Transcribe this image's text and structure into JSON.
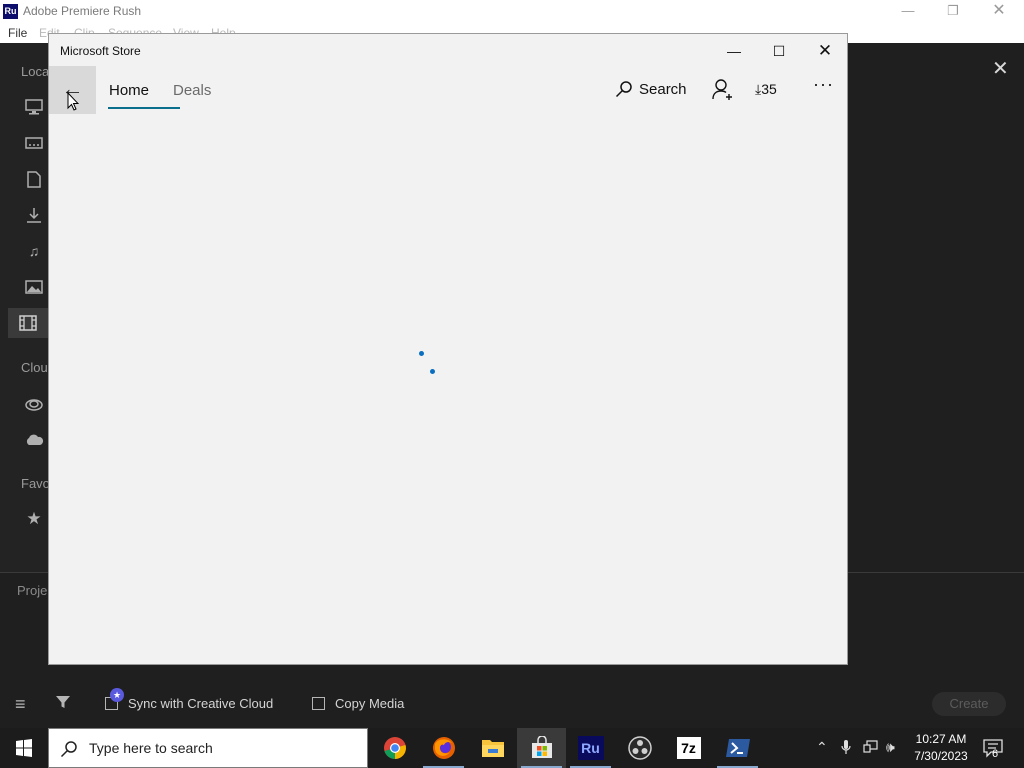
{
  "rush": {
    "title": "Adobe Premiere Rush",
    "logo": "Ru",
    "menu": [
      "File",
      "Edit",
      "Clip",
      "Sequence",
      "View",
      "Help"
    ],
    "sidebar": {
      "local_label": "Loca",
      "cloud_label": "Clou",
      "favorites_label": "Favo",
      "icons": [
        "monitor-icon",
        "drive-icon",
        "document-icon",
        "download-icon",
        "music-icon",
        "image-icon",
        "film-icon",
        "creative-cloud-icon",
        "cloud-icon",
        "star-icon"
      ]
    },
    "project_label": "Proje",
    "footer": {
      "sync_label": "Sync with Creative Cloud",
      "copy_media_label": "Copy Media",
      "create_label": "Create"
    }
  },
  "store": {
    "title": "Microsoft Store",
    "tabs": [
      {
        "label": "Home",
        "selected": true
      },
      {
        "label": "Deals",
        "selected": false
      }
    ],
    "search_label": "Search",
    "downloads_count": "35",
    "more_label": "···",
    "accent": "#0a6f8c",
    "spinner_color": "#0a6fc0"
  },
  "taskbar": {
    "search_placeholder": "Type here to search",
    "apps": [
      "chrome-icon",
      "firefox-icon",
      "file-explorer-icon",
      "microsoft-store-icon",
      "premiere-rush-icon",
      "obs-icon",
      "7zip-icon",
      "powershell-icon"
    ],
    "rush_label": "Ru",
    "zip_label": "7z",
    "time": "10:27 AM",
    "date": "7/30/2023",
    "notification_count": "6"
  }
}
